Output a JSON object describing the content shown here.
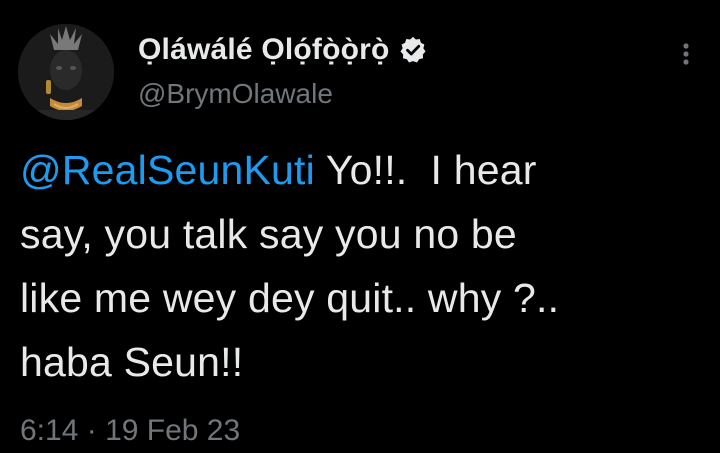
{
  "tweet": {
    "author": {
      "display_name": "Ọláwálé Ọlọ́fọ̀ọ̀rọ̀",
      "handle": "@BrymOlawale",
      "verified": true,
      "avatar_icon": "avatar-photo"
    },
    "text": {
      "mention": "@RealSeunKuti",
      "line1_rest": "Yo!!.  I hear",
      "line2": "say, you talk say you no be",
      "line3": "like me wey dey quit.. why ?..",
      "line4": "haba Seun!!"
    },
    "time": "6:14",
    "separator": "·",
    "date": "19 Feb 23",
    "more_icon": "more-vertical-icon"
  },
  "colors": {
    "background": "#000000",
    "text_primary": "#e7e9ea",
    "text_secondary": "#71767b",
    "link": "#1d9bf0"
  }
}
